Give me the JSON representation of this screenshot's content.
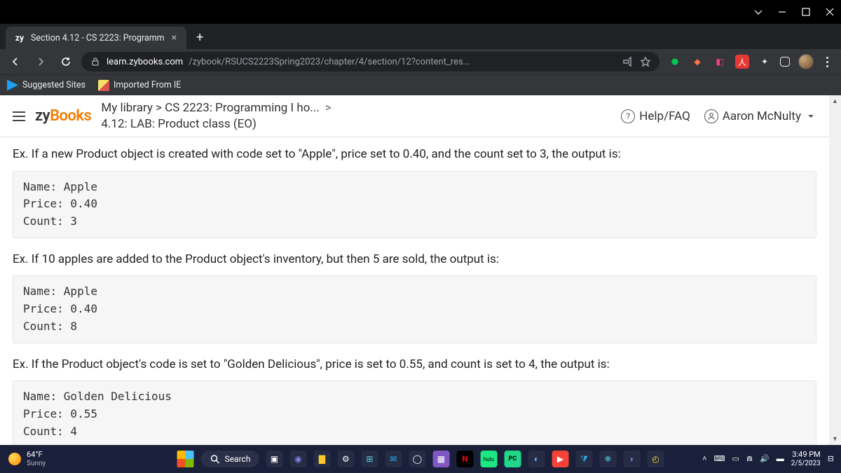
{
  "window": {
    "tab_title": "Section 4.12 - CS 2223: Programm",
    "favicon": "zy",
    "url_host": "learn.zybooks.com",
    "url_path": "/zybook/RSUCS2223Spring2023/chapter/4/section/12?content_res..."
  },
  "bookmarks": {
    "suggested": "Suggested Sites",
    "imported": "Imported From IE"
  },
  "zybooks": {
    "logo_zy": "zy",
    "logo_books": "Books",
    "breadcrumb": "My library > CS 2223: Programming I ho...",
    "breadcrumb_caret": ">",
    "section": "4.12: LAB: Product class (EO)",
    "help": "Help/FAQ",
    "user": "Aaron McNulty"
  },
  "content": {
    "para1": "Ex. If a new Product object is created with code set to \"Apple\", price set to 0.40, and the count set to 3, the output is:",
    "code1": "Name: Apple\nPrice: 0.40\nCount: 3",
    "para2": "Ex. If 10 apples are added to the Product object's inventory, but then 5 are sold, the output is:",
    "code2": "Name: Apple\nPrice: 0.40\nCount: 8",
    "para3": "Ex. If the Product object's code is set to \"Golden Delicious\", price is set to 0.55, and count is set to 4, the output is:",
    "code3": "Name: Golden Delicious\nPrice: 0.55\nCount: 4"
  },
  "taskbar": {
    "temp": "64°F",
    "cond": "Sunny",
    "search": "Search",
    "time": "3:49 PM",
    "date": "2/5/2023"
  }
}
